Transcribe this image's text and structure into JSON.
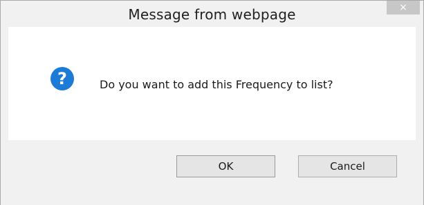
{
  "dialog": {
    "title": "Message from webpage",
    "close_label": "×",
    "icon": "question-icon",
    "message": "Do you want to add this Frequency to list?",
    "buttons": {
      "ok_label": "OK",
      "cancel_label": "Cancel"
    }
  },
  "colors": {
    "icon_blue": "#1b7bd6",
    "close_button_bg": "#c7c7c7",
    "dialog_bg": "#f1f1f1",
    "content_bg": "#ffffff"
  }
}
